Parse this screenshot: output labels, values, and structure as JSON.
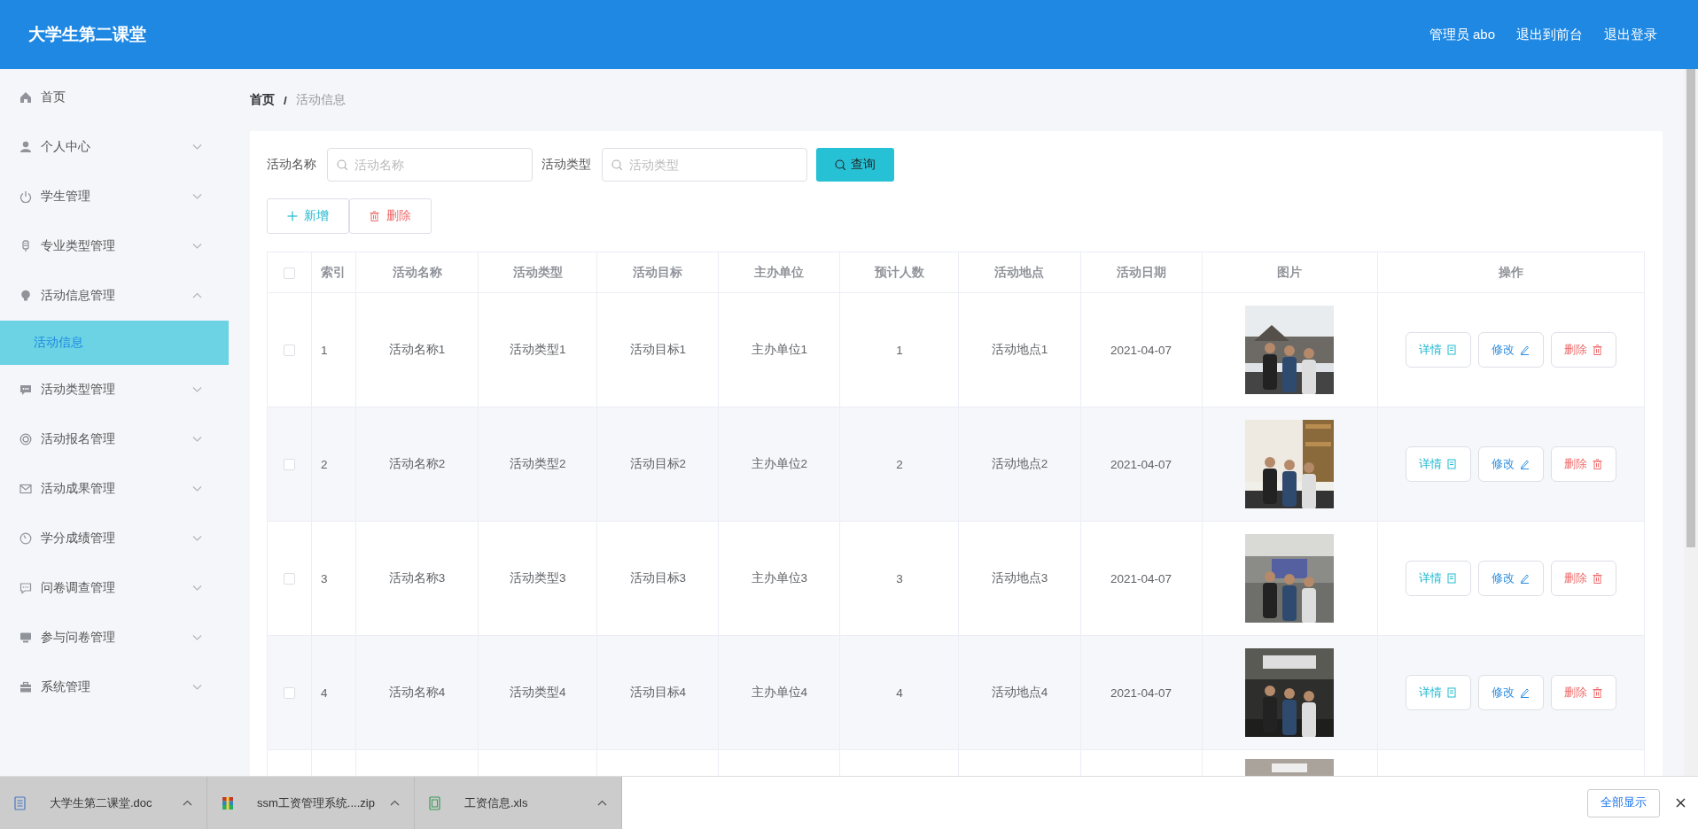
{
  "header": {
    "title": "大学生第二课堂",
    "user": "管理员 abo",
    "links": [
      "退出到前台",
      "退出登录"
    ]
  },
  "sidebar": {
    "items": [
      {
        "label": "首页"
      },
      {
        "label": "个人中心",
        "expanded": false
      },
      {
        "label": "学生管理",
        "expanded": false
      },
      {
        "label": "专业类型管理",
        "expanded": false
      },
      {
        "label": "活动信息管理",
        "expanded": true,
        "children": [
          {
            "label": "活动信息",
            "selected": true
          }
        ]
      },
      {
        "label": "活动类型管理",
        "expanded": false
      },
      {
        "label": "活动报名管理",
        "expanded": false
      },
      {
        "label": "活动成果管理",
        "expanded": false
      },
      {
        "label": "学分成绩管理",
        "expanded": false
      },
      {
        "label": "问卷调查管理",
        "expanded": false
      },
      {
        "label": "参与问卷管理",
        "expanded": false
      },
      {
        "label": "系统管理",
        "expanded": false
      }
    ]
  },
  "breadcrumb": {
    "separator": "/",
    "items": [
      "首页",
      "活动信息"
    ]
  },
  "search": {
    "fields": [
      {
        "label": "活动名称",
        "placeholder": "活动名称"
      },
      {
        "label": "活动类型",
        "placeholder": "活动类型"
      }
    ],
    "button": "查询"
  },
  "actions": [
    {
      "kind": "add",
      "label": "新增"
    },
    {
      "kind": "delete",
      "label": "删除"
    }
  ],
  "table": {
    "header_checked": false,
    "columns": [
      "索引",
      "活动名称",
      "活动类型",
      "活动目标",
      "主办单位",
      "预计人数",
      "活动地点",
      "活动日期",
      "图片",
      "操作"
    ],
    "rows": [
      {
        "kind": "full",
        "checked": false,
        "cells": [
          "1",
          "活动名称1",
          "活动类型1",
          "活动目标1",
          "主办单位1",
          "1",
          "活动地点1",
          "2021-04-07"
        ],
        "buttons": [
          {
            "kind": "detail",
            "label": "详情"
          },
          {
            "kind": "edit",
            "label": "修改"
          },
          {
            "kind": "delete",
            "label": "删除"
          }
        ]
      },
      {
        "kind": "full",
        "checked": false,
        "cells": [
          "2",
          "活动名称2",
          "活动类型2",
          "活动目标2",
          "主办单位2",
          "2",
          "活动地点2",
          "2021-04-07"
        ],
        "buttons": [
          {
            "kind": "detail",
            "label": "详情"
          },
          {
            "kind": "edit",
            "label": "修改"
          },
          {
            "kind": "delete",
            "label": "删除"
          }
        ]
      },
      {
        "kind": "full",
        "checked": false,
        "cells": [
          "3",
          "活动名称3",
          "活动类型3",
          "活动目标3",
          "主办单位3",
          "3",
          "活动地点3",
          "2021-04-07"
        ],
        "buttons": [
          {
            "kind": "detail",
            "label": "详情"
          },
          {
            "kind": "edit",
            "label": "修改"
          },
          {
            "kind": "delete",
            "label": "删除"
          }
        ]
      },
      {
        "kind": "full",
        "checked": false,
        "cells": [
          "4",
          "活动名称4",
          "活动类型4",
          "活动目标4",
          "主办单位4",
          "4",
          "活动地点4",
          "2021-04-07"
        ],
        "buttons": [
          {
            "kind": "detail",
            "label": "详情"
          },
          {
            "kind": "edit",
            "label": "修改"
          },
          {
            "kind": "delete",
            "label": "删除"
          }
        ]
      },
      {
        "kind": "partial"
      }
    ]
  },
  "downloads": {
    "files": [
      {
        "kind": "doc",
        "name": "大学生第二课堂.doc"
      },
      {
        "kind": "zip",
        "name": "ssm工资管理系统....zip"
      },
      {
        "kind": "xls",
        "name": "工资信息.xls"
      }
    ],
    "show_all": "全部显示"
  }
}
